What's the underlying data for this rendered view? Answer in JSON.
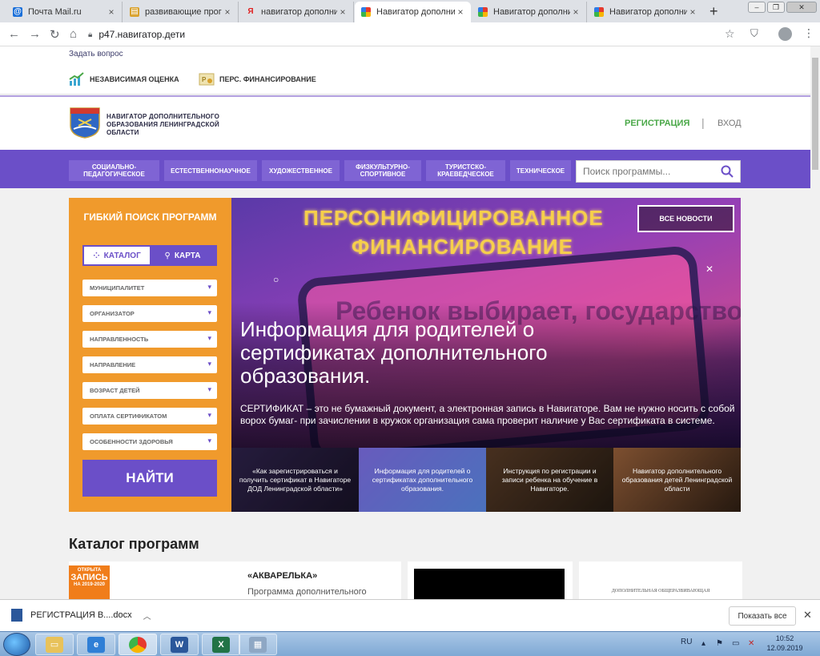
{
  "browser": {
    "tabs": [
      {
        "label": "Почта Mail.ru",
        "icon": "mail-icon"
      },
      {
        "label": "развивающие прогр",
        "icon": "doc-icon"
      },
      {
        "label": "навигатор дополнит",
        "icon": "yandex-icon"
      },
      {
        "label": "Навигатор дополнит",
        "icon": "navigator-icon"
      },
      {
        "label": "Навигатор дополнит",
        "icon": "navigator-icon"
      },
      {
        "label": "Навигатор дополнит",
        "icon": "navigator-icon"
      }
    ],
    "url": "p47.навигатор.дети"
  },
  "site": {
    "ask_question": "Задать вопрос",
    "sublinks": [
      "НЕЗАВИСИМАЯ ОЦЕНКА",
      "ПЕРС. ФИНАНСИРОВАНИЕ"
    ],
    "brand": "НАВИГАТОР ДОПОЛНИТЕЛЬНОГО ОБРАЗОВАНИЯ ЛЕНИНГРАДСКОЙ ОБЛАСТИ",
    "register": "РЕГИСТРАЦИЯ",
    "separator": "|",
    "login": "ВХОД",
    "menu": [
      "СОЦИАЛЬНО-ПЕДАГОГИЧЕСКОЕ",
      "ЕСТЕСТВЕННОНАУЧНОЕ",
      "ХУДОЖЕСТВЕННОЕ",
      "ФИЗКУЛЬТУРНО-СПОРТИВНОЕ",
      "ТУРИСТСКО-КРАЕВЕДЧЕСКОЕ",
      "ТЕХНИЧЕСКОЕ"
    ],
    "search_placeholder": "Поиск программы..."
  },
  "filters": {
    "title": "ГИБКИЙ ПОИСК ПРОГРАММ",
    "view_catalog": "КАТАЛОГ",
    "view_map": "КАРТА",
    "selects": [
      "МУНИЦИПАЛИТЕТ",
      "ОРГАНИЗАТОР",
      "НАПРАВЛЕННОСТЬ",
      "НАПРАВЛЕНИЕ",
      "ВОЗРАСТ ДЕТЕЙ",
      "ОПЛАТА СЕРТИФИКАТОМ",
      "ОСОБЕННОСТИ ЗДОРОВЬЯ"
    ],
    "find": "НАЙТИ"
  },
  "hero": {
    "banner_line1": "ПЕРСОНИФИЦИРОВАННОЕ",
    "banner_line2": "ФИНАНСИРОВАНИЕ",
    "bg_text": "Ребенок выбирает, государство оплачивает",
    "all_news": "ВСЕ НОВОСТИ",
    "title": "Информация для родителей о сертификатах дополнительного образования.",
    "text": "СЕРТИФИКАТ – это не бумажный документ, а электронная запись в Навигаторе. Вам не нужно носить с собой ворох бумаг- при зачислении в кружок организация сама проверит наличие у Вас сертификата в системе."
  },
  "thumbs": [
    "«Как зарегистрироваться и получить сертификат в Навигаторе ДОД Ленинградской области»",
    "Информация для родителей о сертификатах дополнительного образования.",
    "Инструкция по регистрации и записи ребенка на обучение в Навигаторе.",
    "Навигатор дополнительного образования детей Ленинградской области"
  ],
  "catalog": {
    "title": "Каталог программ",
    "badge": [
      "ОТКРЫТА",
      "ЗАПИСЬ",
      "НА 2019-2020"
    ],
    "card1_title": "«АКВАРЕЛЬКА»",
    "card1_sub": "Программа дополнительного",
    "card3_text": "ДОПОЛНИТЕЛЬНАЯ ОБЩЕРАЗВИВАЮЩАЯ"
  },
  "downloads": {
    "file": "РЕГИСТРАЦИЯ В....docx",
    "show_all": "Показать все"
  },
  "taskbar": {
    "lang": "RU",
    "time": "10:52",
    "date": "12.09.2019"
  }
}
